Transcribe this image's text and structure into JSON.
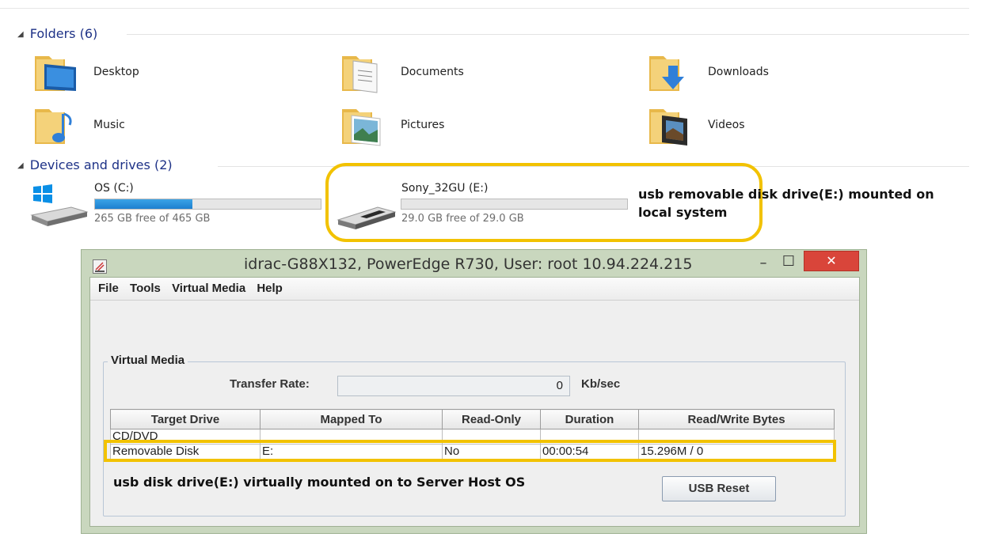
{
  "folders_section": {
    "title": "Folders (6)",
    "items": [
      {
        "label": "Desktop",
        "icon": "desktop-folder-icon"
      },
      {
        "label": "Documents",
        "icon": "documents-folder-icon"
      },
      {
        "label": "Downloads",
        "icon": "downloads-folder-icon"
      },
      {
        "label": "Music",
        "icon": "music-folder-icon"
      },
      {
        "label": "Pictures",
        "icon": "pictures-folder-icon"
      },
      {
        "label": "Videos",
        "icon": "videos-folder-icon"
      }
    ]
  },
  "drives_section": {
    "title": "Devices and drives (2)",
    "drives": [
      {
        "name": "OS (C:)",
        "free": "265 GB free of 465 GB",
        "used_fraction": 0.43,
        "icon": "windows-drive-icon"
      },
      {
        "name": "Sony_32GU (E:)",
        "free": "29.0 GB free of 29.0 GB",
        "used_fraction": 0.0,
        "icon": "usb-drive-icon"
      }
    ]
  },
  "annotations": {
    "local_line1": "usb removable disk drive(E:) mounted on",
    "local_line2": "local system",
    "virtual": "usb disk drive(E:) virtually mounted on to Server Host OS"
  },
  "window": {
    "title": "idrac-G88X132, PowerEdge R730, User: root 10.94.224.215",
    "menu": [
      "File",
      "Tools",
      "Virtual Media",
      "Help"
    ],
    "group_label": "Virtual Media",
    "transfer_rate_label": "Transfer Rate:",
    "transfer_rate_value": "0",
    "transfer_rate_unit": "Kb/sec",
    "table": {
      "headers": [
        "Target Drive",
        "Mapped To",
        "Read-Only",
        "Duration",
        "Read/Write Bytes"
      ],
      "rows": [
        [
          "CD/DVD",
          "",
          "",
          "",
          ""
        ],
        [
          "Removable Disk",
          "E:",
          "No",
          "00:00:54",
          "15.296M / 0"
        ]
      ]
    },
    "usb_reset_label": "USB Reset",
    "minimize_symbol": "–",
    "maximize_symbol": "☐",
    "close_symbol": "✕"
  },
  "colors": {
    "highlight": "#f2c200",
    "progress": "#1d7fd0",
    "section_heading": "#1e3287",
    "close_button": "#d9453a"
  }
}
